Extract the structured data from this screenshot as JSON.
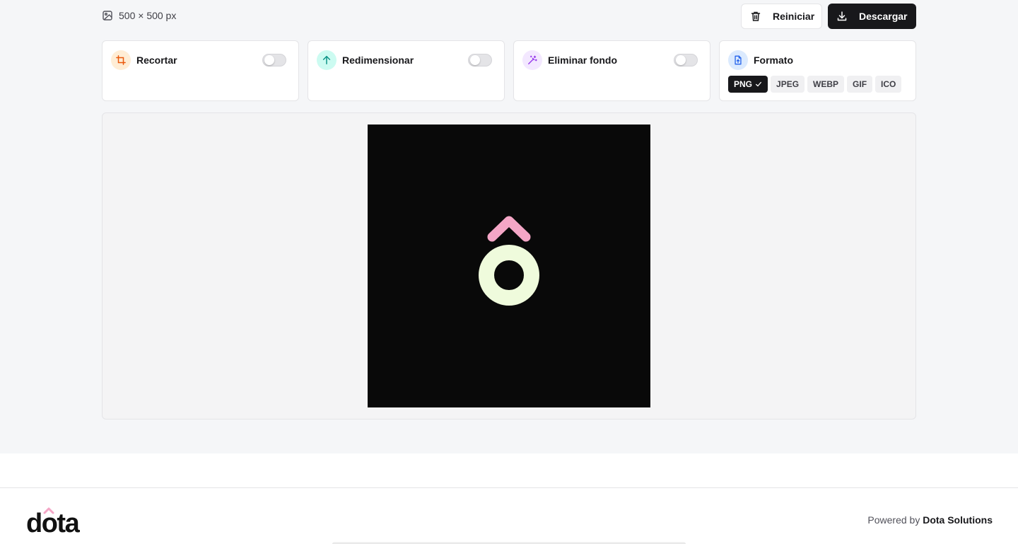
{
  "image_info": {
    "dimensions": "500 × 500 px"
  },
  "toolbar": {
    "reset_label": "Reiniciar",
    "download_label": "Descargar"
  },
  "tools": [
    {
      "title": "Recortar",
      "icon": "crop-icon",
      "accent": "#ea580c",
      "badge_bg": "#ffedd5",
      "enabled": false
    },
    {
      "title": "Redimensionar",
      "icon": "arrow-up-icon",
      "accent": "#0d9488",
      "badge_bg": "#ccfbf1",
      "enabled": false
    },
    {
      "title": "Eliminar fondo",
      "icon": "magic-wand-icon",
      "accent": "#9333ea",
      "badge_bg": "#f3e8ff",
      "enabled": false
    }
  ],
  "format": {
    "title": "Formato",
    "icon": "file-upload-icon",
    "accent": "#2563eb",
    "badge_bg": "#dbeafe",
    "options": [
      "PNG",
      "JPEG",
      "WEBP",
      "GIF",
      "ICO"
    ],
    "selected": "PNG"
  },
  "preview": {
    "background": "#090909",
    "ring_color": "#effbdc",
    "caret_color": "#f4a6c6"
  },
  "footer": {
    "logo_text": "dota",
    "powered_prefix": "Powered by",
    "powered_name": "Dota Solutions"
  }
}
